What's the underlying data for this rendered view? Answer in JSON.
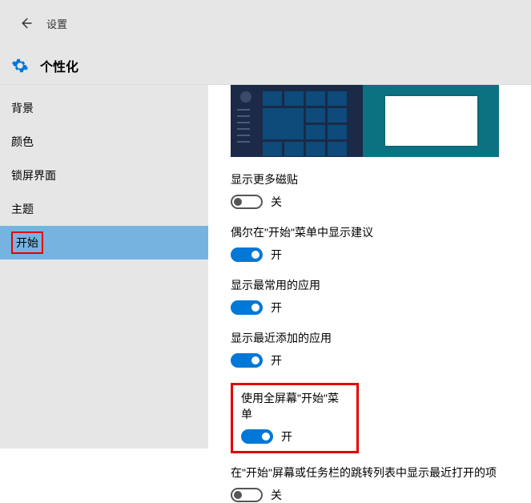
{
  "header": {
    "title": "设置"
  },
  "subheader": {
    "title": "个性化"
  },
  "sidebar": {
    "items": [
      {
        "label": "背景"
      },
      {
        "label": "颜色"
      },
      {
        "label": "锁屏界面"
      },
      {
        "label": "主题"
      },
      {
        "label": "开始"
      }
    ]
  },
  "settings": [
    {
      "label": "显示更多磁贴",
      "state": "off",
      "state_label": "关"
    },
    {
      "label": "偶尔在\"开始\"菜单中显示建议",
      "state": "on",
      "state_label": "开"
    },
    {
      "label": "显示最常用的应用",
      "state": "on",
      "state_label": "开"
    },
    {
      "label": "显示最近添加的应用",
      "state": "on",
      "state_label": "开"
    },
    {
      "label": "使用全屏幕\"开始\"菜单",
      "state": "on",
      "state_label": "开"
    },
    {
      "label": "在\"开始\"屏幕或任务栏的跳转列表中显示最近打开的项",
      "state": "off",
      "state_label": "关"
    }
  ]
}
